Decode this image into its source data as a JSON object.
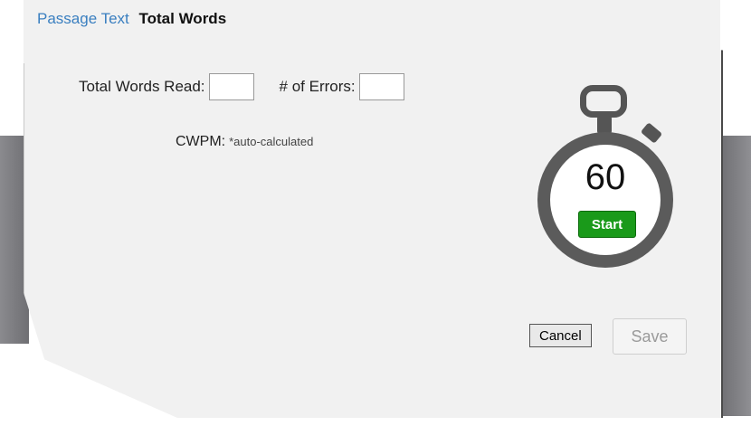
{
  "tabs": {
    "passage_text": "Passage Text",
    "total_words": "Total Words"
  },
  "fields": {
    "total_words_read_label": "Total Words Read:",
    "total_words_read_value": "",
    "errors_label": "# of Errors:",
    "errors_value": ""
  },
  "cwpm": {
    "label": "CWPM:",
    "note": "*auto-calculated"
  },
  "timer": {
    "value": "60",
    "start_label": "Start",
    "icon": "stopwatch-icon",
    "start_color": "#1a9a1a"
  },
  "actions": {
    "cancel_label": "Cancel",
    "save_label": "Save"
  }
}
